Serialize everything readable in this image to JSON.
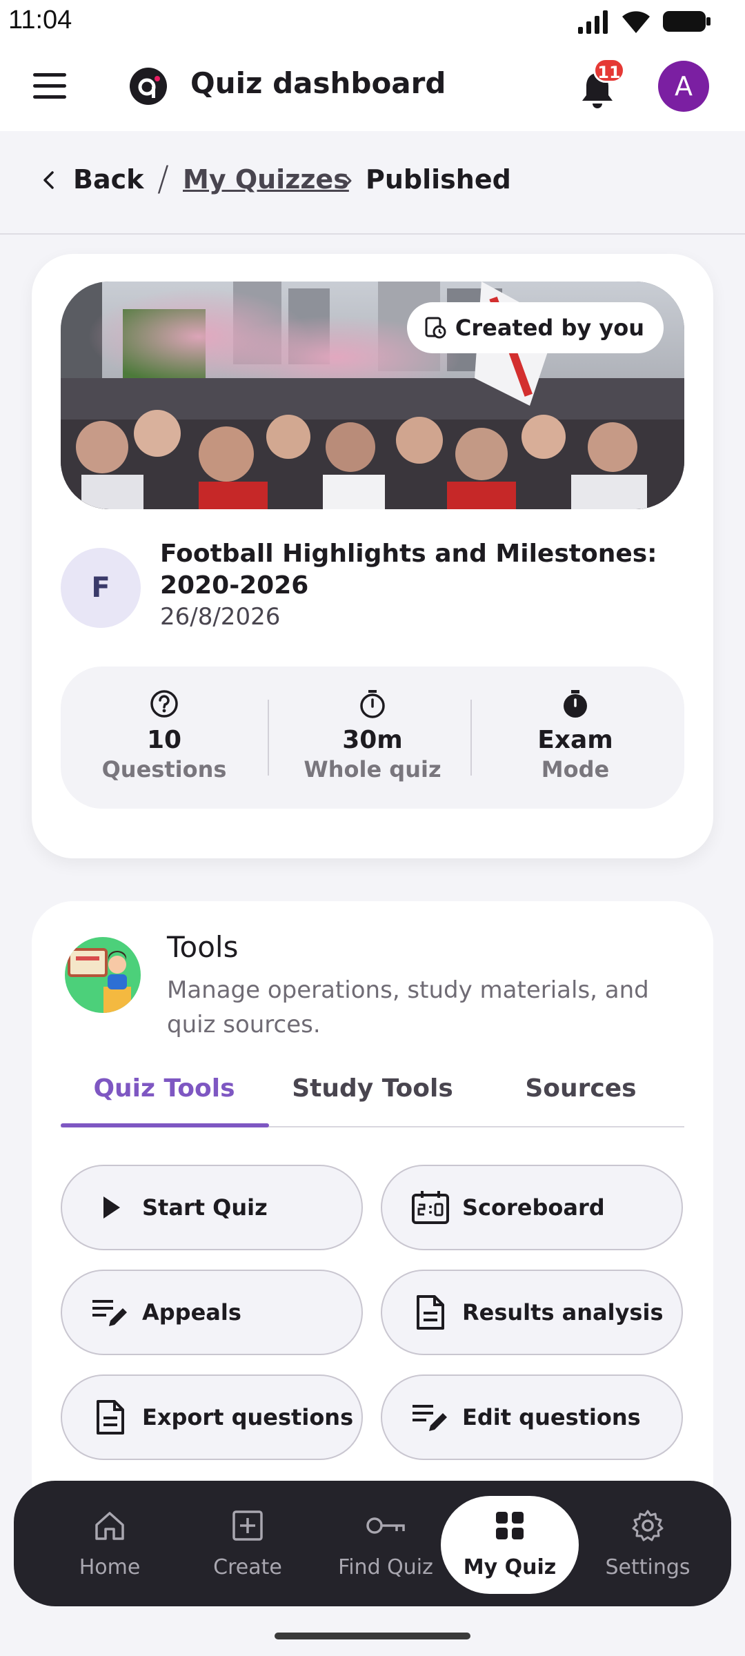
{
  "status_bar": {
    "time": "11:04"
  },
  "header": {
    "title": "Quiz dashboard",
    "notification_count": "11",
    "avatar_initial": "A"
  },
  "breadcrumb": {
    "back": "Back",
    "separator": "/",
    "parent": "My Quizzes",
    "current": "Published"
  },
  "quiz": {
    "badge": "Created by you",
    "initial": "F",
    "title": "Football Highlights and Milestones: 2020-2026",
    "date": "26/8/2026",
    "stats": [
      {
        "icon": "question-icon",
        "value": "10",
        "label": "Questions"
      },
      {
        "icon": "timer-icon",
        "value": "30m",
        "label": "Whole quiz"
      },
      {
        "icon": "stopwatch-icon",
        "value": "Exam",
        "label": "Mode"
      }
    ]
  },
  "tools": {
    "title": "Tools",
    "description": "Manage operations, study materials, and quiz sources.",
    "tabs": [
      {
        "label": "Quiz Tools",
        "active": true
      },
      {
        "label": "Study Tools",
        "active": false
      },
      {
        "label": "Sources",
        "active": false
      }
    ],
    "buttons": [
      {
        "label": "Start Quiz",
        "icon": "play-icon"
      },
      {
        "label": "Scoreboard",
        "icon": "scoreboard-icon"
      },
      {
        "label": "Appeals",
        "icon": "edit-list-icon"
      },
      {
        "label": "Results analysis",
        "icon": "document-icon"
      },
      {
        "label": "Export questions",
        "icon": "document-icon"
      },
      {
        "label": "Edit questions",
        "icon": "edit-list-icon"
      }
    ]
  },
  "bottom_nav": [
    {
      "label": "Home",
      "icon": "home-icon",
      "active": false
    },
    {
      "label": "Create",
      "icon": "plus-square-icon",
      "active": false
    },
    {
      "label": "Find Quiz",
      "icon": "key-icon",
      "active": false
    },
    {
      "label": "My Quiz",
      "icon": "grid-icon",
      "active": true
    },
    {
      "label": "Settings",
      "icon": "gear-icon",
      "active": false
    }
  ],
  "colors": {
    "accent": "#7e57c2",
    "avatar": "#7b1fa2",
    "badge": "#e53935",
    "nav_bg": "#24232a"
  }
}
